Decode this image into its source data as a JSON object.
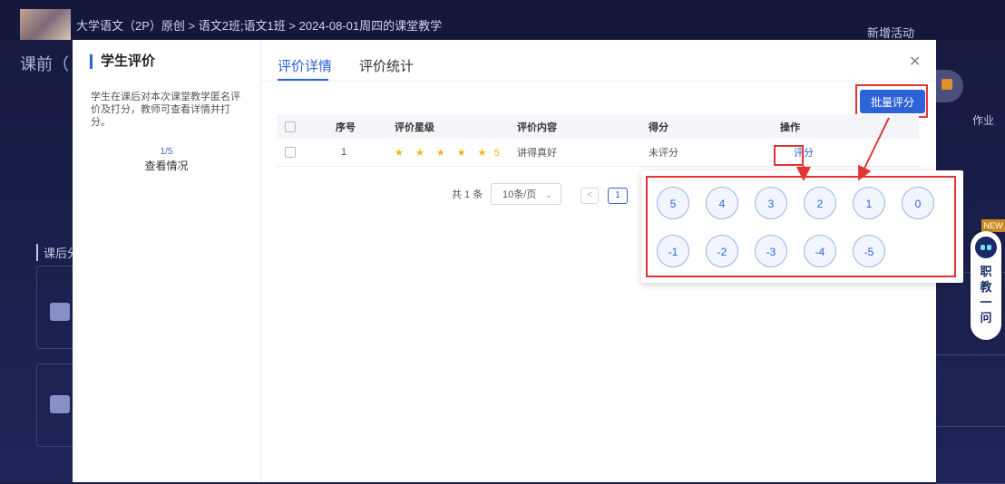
{
  "app": {
    "breadcrumb": "大学语文（2P）原创 > 语文2班;语文1班 > 2024-08-01周四的课堂教学",
    "new_activity": "新增活动",
    "pre_class": "课前（",
    "after_class": "课后分",
    "homework": "作业",
    "tag": "NEW",
    "assistant": [
      "职",
      "教",
      "一",
      "问"
    ]
  },
  "side": {
    "title": "学生评价",
    "description": "学生在课后对本次课堂教学匿名评价及打分，教师可查看详情并打分。",
    "progress": "1/5",
    "view_link": "查看情况"
  },
  "tabs": [
    {
      "label": "评价详情",
      "active": true
    },
    {
      "label": "评价统计",
      "active": false
    }
  ],
  "batch_button": "批量评分",
  "table": {
    "headers": [
      "",
      "序号",
      "评价星级",
      "评价内容",
      "得分",
      "操作"
    ],
    "rows": [
      {
        "index": "1",
        "stars": "★ ★ ★ ★ ★",
        "star_value": "5",
        "content": "讲得真好",
        "score": "未评分",
        "action": "评分"
      }
    ]
  },
  "pagination": {
    "total": "共 1 条",
    "page_size": "10条/页",
    "prev": "<",
    "current": "1"
  },
  "score_options": {
    "row1": [
      "5",
      "4",
      "3",
      "2",
      "1",
      "0"
    ],
    "row2": [
      "-1",
      "-2",
      "-3",
      "-4",
      "-5"
    ]
  },
  "colors": {
    "primary": "#2e63d8",
    "highlight": "#e23434",
    "star": "#f6b31b"
  }
}
